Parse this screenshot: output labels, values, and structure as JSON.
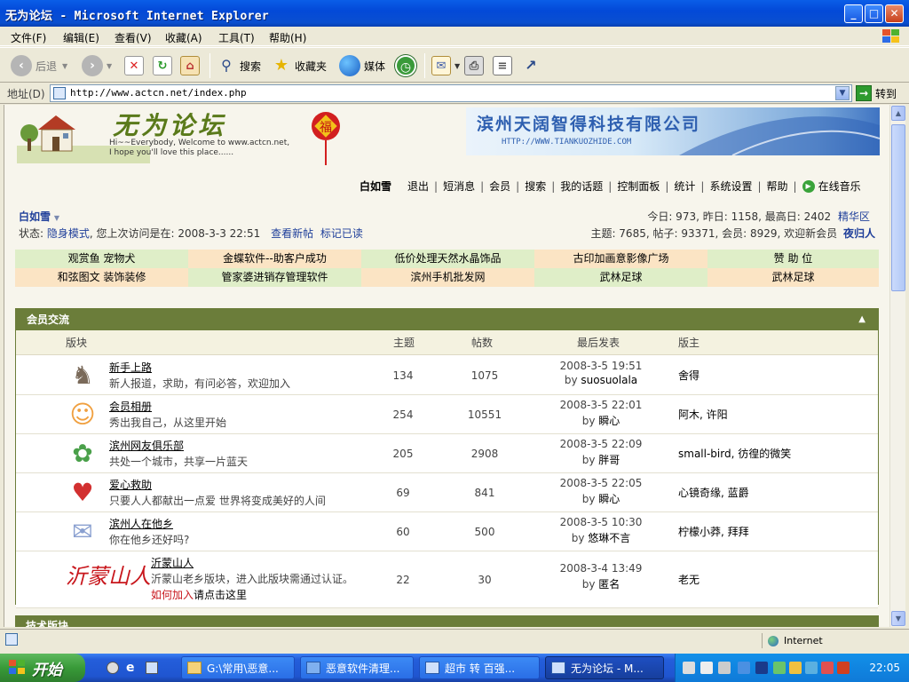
{
  "window": {
    "title": "无为论坛 - Microsoft Internet Explorer",
    "menu": [
      "文件(F)",
      "编辑(E)",
      "查看(V)",
      "收藏(A)",
      "工具(T)",
      "帮助(H)"
    ]
  },
  "toolbar": {
    "back": "后退",
    "search": "搜索",
    "favorites": "收藏夹",
    "media": "媒体"
  },
  "address": {
    "label": "地址(D)",
    "url": "http://www.actcn.net/index.php",
    "go": "转到"
  },
  "forum": {
    "logo_title": "无为论坛",
    "logo_line1": "Hi~~Everybody, Welcome to www.actcn.net,",
    "logo_line2": "I hope you'll love this place......",
    "banner_text": "滨州天阔智得科技有限公司",
    "banner_url": "HTTP://WWW.TIANKUOZHIDE.COM",
    "nav": {
      "user": "白如雪",
      "items": [
        "退出",
        "短消息",
        "会员",
        "搜索",
        "我的话题",
        "控制面板",
        "统计",
        "系统设置",
        "帮助"
      ],
      "music": "在线音乐"
    },
    "user_info": {
      "name": "白如雪",
      "status_prefix": "状态:",
      "status_mode": "隐身模式",
      "last_visit": ", 您上次访问是在: 2008-3-3 22:51",
      "view_new": "查看新帖",
      "mark_read": "标记已读"
    },
    "stats": {
      "line1": "今日: 973, 昨日: 1158, 最高日: 2402",
      "highlight": "精华区",
      "line2": "主题: 7685, 帖子: 93371, 会员: 8929, 欢迎新会员",
      "newest": "夜归人"
    },
    "ads": [
      [
        "观赏鱼  宠物犬",
        "金蝶软件--助客户成功",
        "低价处理天然水晶饰品",
        "古印加画意影像广场",
        "赞 助 位"
      ],
      [
        "和弦图文  装饰装修",
        "管家婆进销存管理软件",
        "滨州手机批发网",
        "武林足球",
        "武林足球"
      ]
    ],
    "section": {
      "title": "会员交流",
      "columns": [
        "版块",
        "主题",
        "帖数",
        "最后发表",
        "版主"
      ],
      "rows": [
        {
          "name": "新手上路",
          "desc": "新人报道，求助，有问必答，欢迎加入",
          "topics": "134",
          "posts": "1075",
          "last_time": "2008-3-5 19:51",
          "last_by": "by",
          "last_user": "suosuolala",
          "mods": "舍得",
          "icon": "donkey-icon"
        },
        {
          "name": "会员相册",
          "desc": "秀出我自己，从这里开始",
          "topics": "254",
          "posts": "10551",
          "last_time": "2008-3-5 22:01",
          "last_by": "by",
          "last_user": "瞬心",
          "mods": "阿木, 许阳",
          "icon": "faces-icon"
        },
        {
          "name": "滨州网友俱乐部",
          "desc": "共处一个城市，共享一片蓝天",
          "topics": "205",
          "posts": "2908",
          "last_time": "2008-3-5 22:09",
          "last_by": "by",
          "last_user": "胖哥",
          "mods": "small-bird, 彷徨的微笑",
          "icon": "sprout-icon"
        },
        {
          "name": "爱心救助",
          "desc": "只要人人都献出一点爱 世界将变成美好的人间",
          "topics": "69",
          "posts": "841",
          "last_time": "2008-3-5 22:05",
          "last_by": "by",
          "last_user": "瞬心",
          "mods": "心镜奇缘, 蓝爵",
          "icon": "heart-icon"
        },
        {
          "name": "滨州人在他乡",
          "desc": "你在他乡还好吗?",
          "topics": "60",
          "posts": "500",
          "last_time": "2008-3-5 10:30",
          "last_by": "by",
          "last_user": "悠琳不言",
          "mods": "柠檬小莽, 拜拜",
          "icon": "envelope-icon"
        },
        {
          "name": "沂蒙山人",
          "desc": "沂蒙山老乡版块，进入此版块需通过认证。",
          "join_link": "如何加入",
          "join_tail": "请点击这里",
          "topics": "22",
          "posts": "30",
          "last_time": "2008-3-4 13:49",
          "last_by": "by",
          "last_user": "匿名",
          "mods": "老无",
          "icon": "calligraphy-logo",
          "logo_text": "沂蒙山人"
        }
      ]
    },
    "next_section": "技术版块"
  },
  "statusbar": {
    "zone": "Internet"
  },
  "taskbar": {
    "start": "开始",
    "tasks": [
      "G:\\常用\\恶意...",
      "恶意软件清理...",
      "超市 转 百强...",
      "无为论坛 - M..."
    ],
    "clock": "22:05"
  },
  "colors": {
    "section_header": "#6b7d3a",
    "ad_yellow": "#fbe4c4",
    "ad_green": "#dfeec8",
    "link_blue": "#1f3f9a"
  }
}
